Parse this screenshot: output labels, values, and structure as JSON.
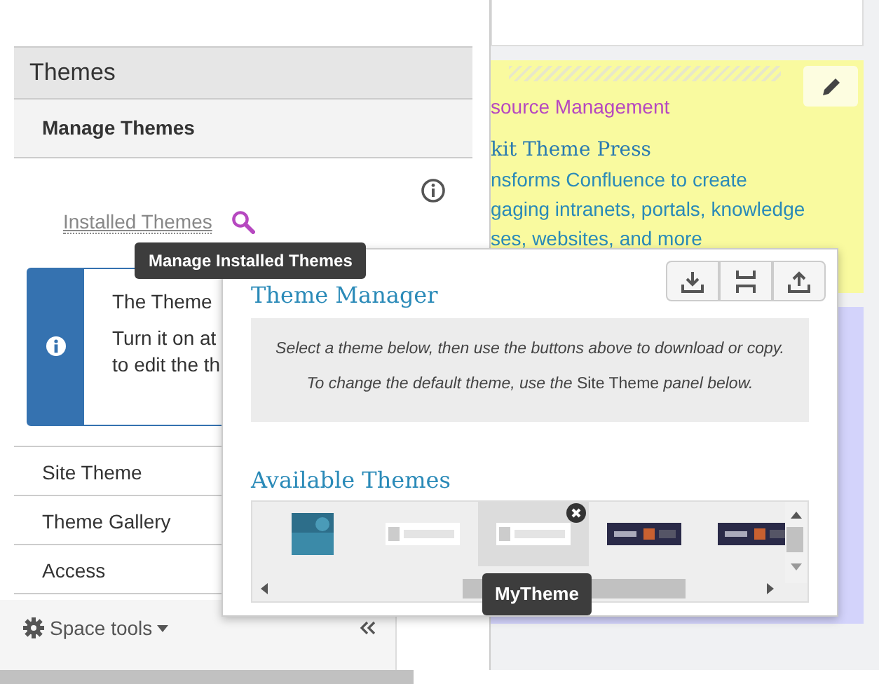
{
  "sidebar": {
    "title": "Themes",
    "section": "Manage Themes",
    "installed_link": "Installed Themes",
    "tooltip": "Manage Installed Themes",
    "info_box": [
      "The Theme",
      "Turn it on at",
      "to edit the th"
    ],
    "nav_items": [
      {
        "label": "Site Theme"
      },
      {
        "label": "Theme Gallery"
      },
      {
        "label": "Access"
      }
    ],
    "footer": "Space tools"
  },
  "content_card": [
    {
      "kind": "link",
      "text": "source Management"
    },
    {
      "kind": "heading",
      "text": "kit Theme Press"
    },
    {
      "kind": "body",
      "text": "nsforms Confluence to create"
    },
    {
      "kind": "body",
      "text": "gaging intranets, portals, knowledge"
    },
    {
      "kind": "body",
      "text": "ses, websites, and more"
    }
  ],
  "theme_manager": {
    "title": "Theme Manager",
    "notes": [
      "Select a theme below, then use the buttons above to download or copy.",
      "*To change the default theme, use the* Site Theme *panel below.*"
    ],
    "available_title": "Available Themes",
    "themes": [
      {
        "kind": "square",
        "selected": false
      },
      {
        "kind": "banner",
        "selected": false
      },
      {
        "kind": "banner",
        "selected": true
      },
      {
        "kind": "dark",
        "selected": false
      },
      {
        "kind": "dark",
        "selected": false
      }
    ],
    "selected_tooltip": "MyTheme"
  }
}
